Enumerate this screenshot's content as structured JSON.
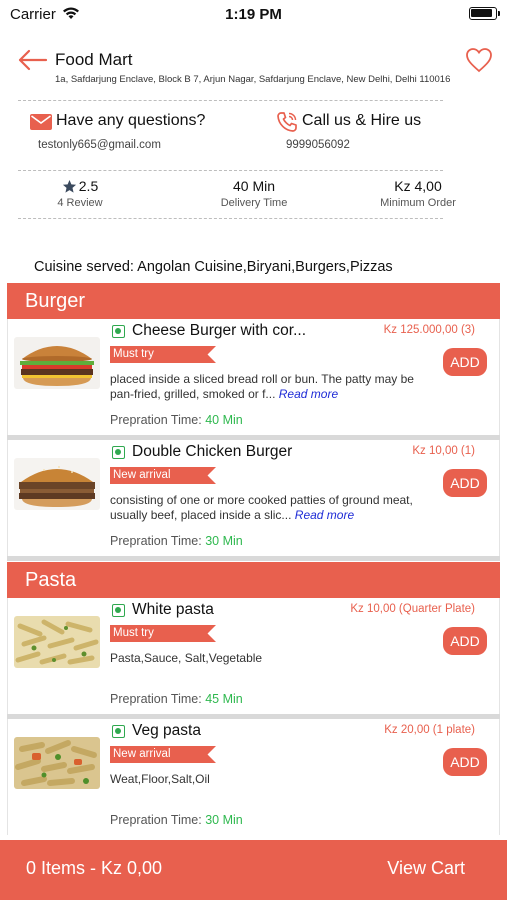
{
  "status_bar": {
    "carrier": "Carrier",
    "time": "1:19 PM"
  },
  "store": {
    "name": "Food Mart",
    "address": "1a, Safdarjung Enclave, Block B 7, Arjun Nagar, Safdarjung Enclave, New Delhi, Delhi 110016"
  },
  "contact": {
    "questions_label": "Have any questions?",
    "email": "testonly665@gmail.com",
    "call_label": "Call us & Hire us",
    "phone": "9999056092"
  },
  "stats": {
    "rating": "2.5",
    "reviews": "4 Review",
    "delivery_time": "40 Min",
    "delivery_label": "Delivery Time",
    "minimum": "Kz 4,00",
    "minimum_label": "Minimum Order"
  },
  "cuisine": "Cuisine served: Angolan Cuisine,Biryani,Burgers,Pizzas",
  "categories": [
    {
      "name": "Burger",
      "items": [
        {
          "name": "Cheese Burger with cor...",
          "price": "Kz 125.000,00 (3)",
          "tag": "Must try",
          "desc": "placed inside a sliced bread roll or bun. The patty may be pan-fried, grilled, smoked or f...",
          "read_more": "Read more",
          "prep_label": "Prepration Time:",
          "prep_time": "40 Min",
          "add": "ADD"
        },
        {
          "name": "Double Chicken Burger",
          "price": "Kz 10,00 (1)",
          "tag": "New arrival",
          "desc": "consisting of one or more cooked patties of ground meat, usually beef, placed inside a slic...",
          "read_more": "Read more",
          "prep_label": "Prepration Time:",
          "prep_time": "30 Min",
          "add": "ADD"
        }
      ]
    },
    {
      "name": "Pasta",
      "items": [
        {
          "name": "White pasta",
          "price": "Kz 10,00 (Quarter Plate)",
          "tag": "Must try",
          "desc": "Pasta,Sauce, Salt,Vegetable",
          "prep_label": "Prepration Time:",
          "prep_time": "45 Min",
          "add": "ADD"
        },
        {
          "name": "Veg pasta",
          "price": "Kz 20,00 (1 plate)",
          "tag": "New arrival",
          "desc": "Weat,Floor,Salt,Oil",
          "prep_label": "Prepration Time:",
          "prep_time": "30 Min",
          "add": "ADD"
        }
      ]
    }
  ],
  "cart": {
    "summary": "0 Items - Kz 0,00",
    "view_cart": "View Cart"
  },
  "colors": {
    "accent": "#e8604e",
    "veg_green": "#2fa84f",
    "link_blue": "#1e2bd6"
  }
}
